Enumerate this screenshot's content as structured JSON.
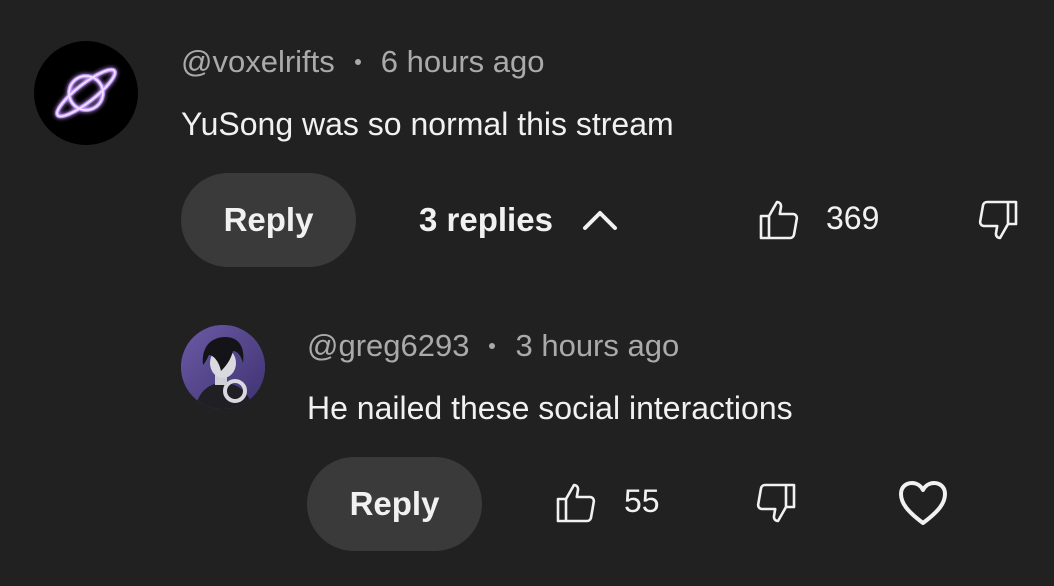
{
  "comment": {
    "author": "@voxelrifts",
    "time": "6 hours ago",
    "text": "YuSong was so normal this stream",
    "reply_label": "Reply",
    "replies_label": "3 replies",
    "like_count": "369",
    "avatar_icon": "planet-icon",
    "avatar_accent": "#b07cff"
  },
  "reply": {
    "author": "@greg6293",
    "time": "3 hours ago",
    "text": "He nailed these social interactions",
    "reply_label": "Reply",
    "like_count": "55"
  },
  "colors": {
    "background": "#212121",
    "button": "#3a3a3a",
    "meta_text": "#aaaaaa",
    "primary_text": "#f1f1f1"
  }
}
